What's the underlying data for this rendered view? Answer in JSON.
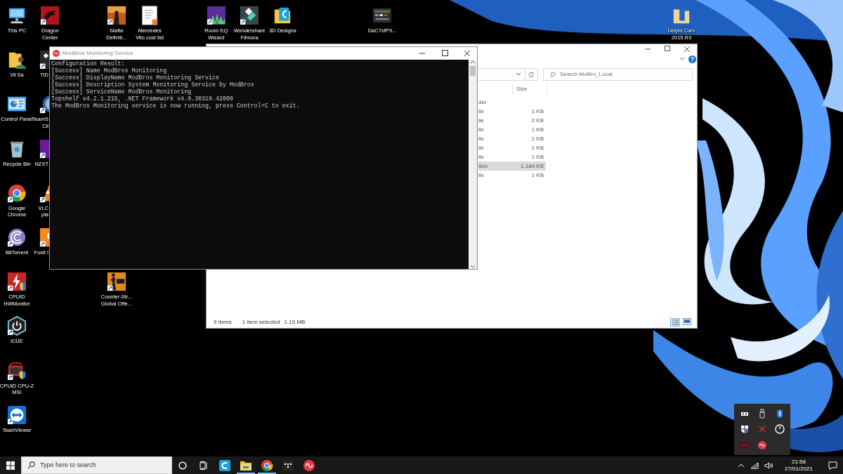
{
  "desktop_icons": [
    {
      "lines": [
        "This PC"
      ],
      "kind": "full"
    },
    {
      "lines": [
        "Dragon",
        "Center"
      ],
      "kind": "full"
    },
    {
      "lines": [
        "Mafia",
        "Definiti..."
      ],
      "kind": "full"
    },
    {
      "lines": [
        "Mercedes",
        "Vito cost list"
      ],
      "kind": "full"
    },
    {
      "lines": [
        "Room EQ",
        "Wizard"
      ],
      "kind": "full"
    },
    {
      "lines": [
        "Wondershare",
        "Filmora"
      ],
      "kind": "full"
    },
    {
      "lines": [
        "3D Designs"
      ],
      "kind": "full"
    },
    {
      "lines": [
        "DaC7xfPX..."
      ],
      "kind": "full"
    },
    {
      "lines": [
        "Delphi Cars",
        "2015.R3"
      ],
      "kind": "full"
    },
    {
      "lines": [
        "Vil Sa"
      ],
      "kind": "full"
    },
    {
      "lines": [
        "TID"
      ],
      "kind": "partial"
    },
    {
      "lines": [
        "Control Panel"
      ],
      "kind": "full"
    },
    {
      "lines": [
        "TeamS",
        "Cli"
      ],
      "kind": "partial"
    },
    {
      "lines": [
        "Recycle Bin"
      ],
      "kind": "full"
    },
    {
      "lines": [
        "NZXT"
      ],
      "kind": "partial"
    },
    {
      "lines": [
        "Google",
        "Chrome"
      ],
      "kind": "full"
    },
    {
      "lines": [
        "VLC",
        "pla"
      ],
      "kind": "partial"
    },
    {
      "lines": [
        "BitTorrent"
      ],
      "kind": "full"
    },
    {
      "lines": [
        "Foxit I"
      ],
      "kind": "partial"
    },
    {
      "lines": [
        "CPUID",
        "HWMonitor"
      ],
      "kind": "full"
    },
    {
      "lines": [
        "Counter-Str...",
        "Global Offe..."
      ],
      "kind": "full"
    },
    {
      "lines": [
        "iCUE"
      ],
      "kind": "full"
    },
    {
      "lines": [
        "CPUID CPU-Z",
        "MSI"
      ],
      "kind": "full"
    },
    {
      "lines": [
        "TeamViewer"
      ],
      "kind": "full"
    }
  ],
  "console": {
    "title": "ModBros Monitoring Service",
    "lines": [
      "Configuration Result:",
      "[Success] Name ModBros Monitoring",
      "[Success] DisplayName ModBros Monitoring Service",
      "[Success] Description System Monitoring Service by ModBros",
      "[Success] ServiceName ModBros Monitoring",
      "Topshelf v4.2.1.215, .NET Framework v4.0.30319.42000",
      "The ModBros Monitoring service is now running, press Control+C to exit."
    ]
  },
  "explorer": {
    "search": {
      "placeholder": "Search MoBro_Local"
    },
    "columns": [
      {
        "label": "Size"
      }
    ],
    "rows": [
      {
        "type": "der",
        "selected": false
      },
      {
        "type": "ile",
        "size": "1 KB",
        "selected": false
      },
      {
        "type": "ile",
        "size": "2 KB",
        "selected": false
      },
      {
        "type": "ile",
        "size": "1 KB",
        "selected": false
      },
      {
        "type": "ile",
        "size": "1 KB",
        "selected": false
      },
      {
        "type": "ile",
        "size": "1 KB",
        "selected": false
      },
      {
        "type": "ile",
        "size": "1 KB",
        "selected": false
      },
      {
        "type": "tion",
        "size": "1,184 KB",
        "selected": true
      },
      {
        "type": "ile",
        "size": "1 KB",
        "selected": false
      }
    ],
    "status": {
      "items": "9 items",
      "selection": "1 item selected",
      "selection_size": "1.15 MB"
    }
  },
  "taskbar": {
    "search": {
      "placeholder": "Type here to search"
    },
    "apps": [
      {
        "kind": "designs",
        "running": false
      },
      {
        "kind": "files",
        "running": true
      },
      {
        "kind": "browser",
        "running": true
      },
      {
        "kind": "dots",
        "running": false
      },
      {
        "kind": "modbros",
        "running": false
      }
    ],
    "time": "21:58",
    "date": "27/01/2021"
  }
}
